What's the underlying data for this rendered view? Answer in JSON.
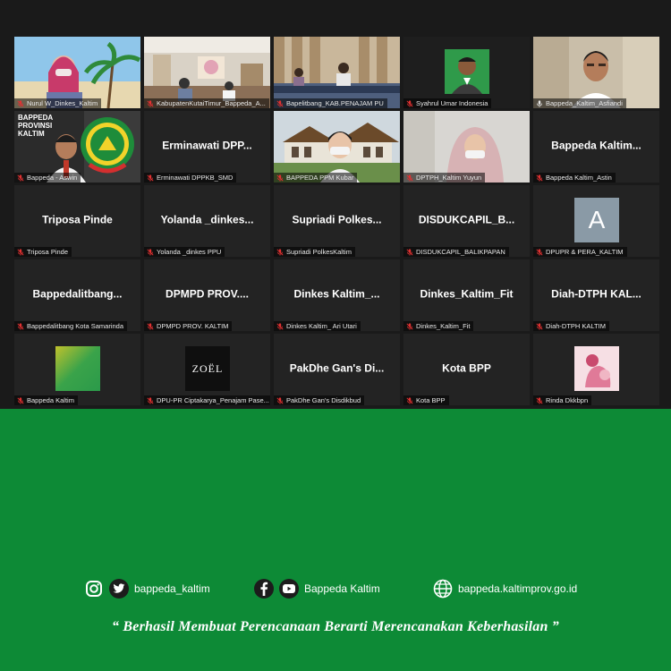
{
  "meeting": {
    "tiles": [
      {
        "name": "Nurul W_Dinkes_Kaltim",
        "muted": true,
        "type": "video",
        "scene": "beach"
      },
      {
        "name": "KabupatenKutaiTimur_Bappeda_A...",
        "muted": true,
        "type": "video",
        "scene": "office"
      },
      {
        "name": "Bapelitbang_KAB.PENAJAM PU",
        "muted": true,
        "type": "video",
        "scene": "meeting-room"
      },
      {
        "name": "Syahrul Umar Indonesia",
        "muted": true,
        "type": "photo",
        "scene": "portrait-green"
      },
      {
        "name": "Bappeda_Kaltim_Asfiandi",
        "muted": false,
        "type": "video",
        "scene": "speaker",
        "active": true
      },
      {
        "name": "Bappeda - Aswin",
        "muted": true,
        "type": "video",
        "scene": "bappeda-logo",
        "overlay_text": [
          "BAPPEDA",
          "PROVINSI",
          "KALTIM"
        ]
      },
      {
        "name": "Erminawati DPPKB_SMD",
        "display": "Erminawati  DPP...",
        "muted": true,
        "type": "text"
      },
      {
        "name": "BAPPEDA PPM Kubar",
        "muted": true,
        "type": "video",
        "scene": "building"
      },
      {
        "name": "DPTPH_Kaltim Yuyun",
        "muted": true,
        "type": "video",
        "scene": "hijab"
      },
      {
        "name": "Bappeda Kaltim_Astin",
        "display": "Bappeda  Kaltim...",
        "muted": true,
        "type": "text"
      },
      {
        "name": "Triposa Pinde",
        "display": "Triposa  Pinde",
        "muted": true,
        "type": "text"
      },
      {
        "name": "Yolanda _dinkes PPU",
        "display": "Yolanda  _dinkes...",
        "muted": true,
        "type": "text"
      },
      {
        "name": "Supriadi PolkesKaltim",
        "display": "Supriadi  Polkes...",
        "muted": true,
        "type": "text"
      },
      {
        "name": "DISDUKCAPIL_BALIKPAPAN",
        "display": "DISDUKCAPIL_B...",
        "muted": true,
        "type": "text"
      },
      {
        "name": "DPUPR & PERA_KALTIM",
        "muted": true,
        "type": "avatar",
        "letter": "A"
      },
      {
        "name": "Bappedalitbang Kota Samarinda",
        "display": "Bappedalitbang...",
        "muted": true,
        "type": "text"
      },
      {
        "name": "DPMPD PROV. KALTIM",
        "display": "DPMPD  PROV....",
        "muted": true,
        "type": "text"
      },
      {
        "name": "Dinkes Kaltim_ Ari Utari",
        "display": "Dinkes  Kaltim_...",
        "muted": true,
        "type": "text"
      },
      {
        "name": "Dinkes_Kaltim_Fit",
        "display": "Dinkes_Kaltim_Fit",
        "muted": true,
        "type": "text"
      },
      {
        "name": "Diah-DTPH KALTIM",
        "display": "Diah-DTPH  KAL...",
        "muted": true,
        "type": "text"
      },
      {
        "name": "Bappeda Kaltim",
        "muted": true,
        "type": "avatar-image",
        "scene": "green-square"
      },
      {
        "name": "DPU-PR Ciptakarya_Penajam Pase...",
        "muted": true,
        "type": "avatar-image",
        "scene": "zoel",
        "logo_text": "ZOËL"
      },
      {
        "name": "PakDhe Gan's Disdikbud",
        "display": "PakDhe  Gan's  Di...",
        "muted": true,
        "type": "text"
      },
      {
        "name": "Kota BPP",
        "display": "Kota  BPP",
        "muted": true,
        "type": "text"
      },
      {
        "name": "Rinda Dkkbpn",
        "muted": true,
        "type": "avatar-image",
        "scene": "pink"
      }
    ]
  },
  "footer": {
    "instagram_twitter_handle": "bappeda_kaltim",
    "facebook_youtube_name": "Bappeda Kaltim",
    "website": "bappeda.kaltimprov.go.id",
    "tagline": "“ Berhasil  Membuat Perencanaan Berarti Merencanakan Keberhasilan ”"
  },
  "colors": {
    "background": "#1a1a1a",
    "tile": "#232323",
    "banner_green": "#0d8a36",
    "active_border": "#c6d84a",
    "muted_icon": "#e03131"
  }
}
